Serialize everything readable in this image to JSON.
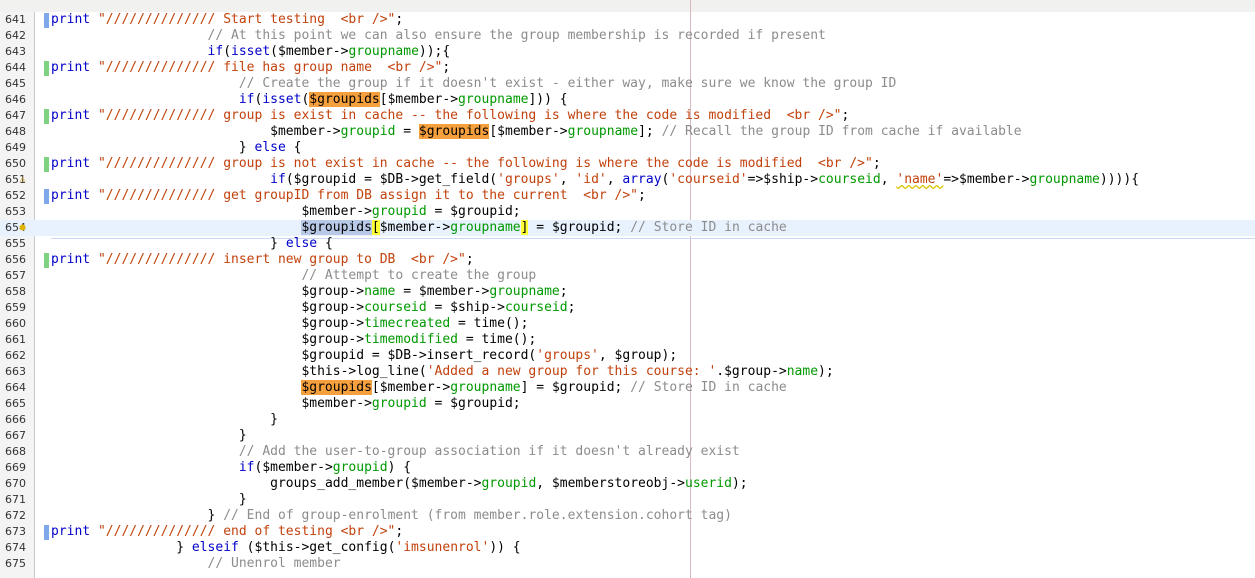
{
  "editor": {
    "lines": [
      {
        "n": "641",
        "ann": "b",
        "mark": "",
        "ind": 0,
        "segs": [
          [
            "kw",
            "print "
          ],
          [
            "str",
            "\"////////////// Start testing  <br />\""
          ],
          [
            "",
            "; "
          ]
        ]
      },
      {
        "n": "642",
        "ann": "",
        "mark": "",
        "ind": 20,
        "segs": [
          [
            "cm",
            "// At this point we can also ensure the group membership is recorded if present"
          ]
        ]
      },
      {
        "n": "643",
        "ann": "",
        "mark": "",
        "ind": 20,
        "segs": [
          [
            "kw",
            "if"
          ],
          [
            "",
            "("
          ],
          [
            "kw",
            "isset"
          ],
          [
            "",
            "($member->"
          ],
          [
            "fld",
            "groupname"
          ],
          [
            "",
            "));{"
          ]
        ]
      },
      {
        "n": "644",
        "ann": "g",
        "mark": "",
        "ind": 0,
        "segs": [
          [
            "kw",
            "print "
          ],
          [
            "str",
            "\"////////////// file has group name  <br />\""
          ],
          [
            "",
            ";"
          ]
        ]
      },
      {
        "n": "645",
        "ann": "",
        "mark": "",
        "ind": 24,
        "segs": [
          [
            "cm",
            "// Create the group if it doesn't exist - either way, make sure we know the group ID"
          ]
        ]
      },
      {
        "n": "646",
        "ann": "",
        "mark": "",
        "ind": 24,
        "segs": [
          [
            "kw",
            "if"
          ],
          [
            "",
            "("
          ],
          [
            "kw",
            "isset"
          ],
          [
            "",
            "("
          ],
          [
            "hl",
            "$groupids"
          ],
          [
            "",
            "[$member->"
          ],
          [
            "fld",
            "groupname"
          ],
          [
            "",
            "])) {"
          ]
        ]
      },
      {
        "n": "647",
        "ann": "g",
        "mark": "",
        "ind": 0,
        "segs": [
          [
            "kw",
            "print "
          ],
          [
            "str",
            "\"////////////// group is exist in cache -- the following is where the code is modified  <br />\""
          ],
          [
            "",
            ";"
          ]
        ]
      },
      {
        "n": "648",
        "ann": "",
        "mark": "",
        "ind": 28,
        "segs": [
          [
            "",
            "$member->"
          ],
          [
            "fld",
            "groupid"
          ],
          [
            "",
            " = "
          ],
          [
            "hl",
            "$groupids"
          ],
          [
            "",
            "[$member->"
          ],
          [
            "fld",
            "groupname"
          ],
          [
            "",
            "]; "
          ],
          [
            "cm",
            "// Recall the group ID from cache if available"
          ]
        ]
      },
      {
        "n": "649",
        "ann": "",
        "mark": "",
        "ind": 24,
        "segs": [
          [
            "",
            "} "
          ],
          [
            "kw",
            "else"
          ],
          [
            "",
            " {"
          ]
        ]
      },
      {
        "n": "650",
        "ann": "g",
        "mark": "",
        "ind": 0,
        "segs": [
          [
            "kw",
            "print "
          ],
          [
            "str",
            "\"////////////// group is not exist in cache -- the following is where the code is modified  <br />\""
          ],
          [
            "",
            ";"
          ]
        ]
      },
      {
        "n": "651",
        "ann": "",
        "mark": "warn-icon",
        "ind": 28,
        "segs": [
          [
            "kw",
            "if"
          ],
          [
            "",
            "($groupid = $DB->get_field("
          ],
          [
            "str",
            "'groups'"
          ],
          [
            "",
            ", "
          ],
          [
            "str",
            "'id'"
          ],
          [
            "",
            ", "
          ],
          [
            "kw",
            "array"
          ],
          [
            "",
            "("
          ],
          [
            "str",
            "'courseid'"
          ],
          [
            "",
            "=>$ship->"
          ],
          [
            "fld",
            "courseid"
          ],
          [
            "",
            ", "
          ],
          [
            "str wav",
            "'name'"
          ],
          [
            "",
            "=>$member->"
          ],
          [
            "fld",
            "groupname"
          ],
          [
            "",
            ")))){"
          ]
        ]
      },
      {
        "n": "652",
        "ann": "b",
        "mark": "",
        "ind": 0,
        "segs": [
          [
            "kw",
            "print "
          ],
          [
            "str",
            "\"////////////// get groupID from DB assign it to the current  <br />\""
          ],
          [
            "",
            ";"
          ]
        ]
      },
      {
        "n": "653",
        "ann": "",
        "mark": "",
        "ind": 32,
        "segs": [
          [
            "",
            "$member->"
          ],
          [
            "fld",
            "groupid"
          ],
          [
            "",
            " = $groupid;"
          ]
        ]
      },
      {
        "n": "654",
        "ann": "",
        "mark": "hint-icon",
        "ind": 32,
        "cur": true,
        "segs": [
          [
            "sel",
            "$groupids"
          ],
          [
            "bm",
            "["
          ],
          [
            "",
            "$member->"
          ],
          [
            "fld",
            "groupname"
          ],
          [
            "bm",
            "]"
          ],
          [
            "",
            " = $groupid; "
          ],
          [
            "cm",
            "// Store ID in cache"
          ]
        ]
      },
      {
        "n": "655",
        "ann": "",
        "mark": "",
        "ind": 28,
        "segs": [
          [
            "",
            "} "
          ],
          [
            "kw",
            "else"
          ],
          [
            "",
            " {"
          ]
        ]
      },
      {
        "n": "656",
        "ann": "g",
        "mark": "",
        "ind": 0,
        "segs": [
          [
            "kw",
            "print "
          ],
          [
            "str",
            "\"////////////// insert new group to DB  <br />\""
          ],
          [
            "",
            ";"
          ]
        ]
      },
      {
        "n": "657",
        "ann": "",
        "mark": "",
        "ind": 32,
        "segs": [
          [
            "cm",
            "// Attempt to create the group"
          ]
        ]
      },
      {
        "n": "658",
        "ann": "",
        "mark": "",
        "ind": 32,
        "segs": [
          [
            "",
            "$group->"
          ],
          [
            "fld",
            "name"
          ],
          [
            "",
            " = $member->"
          ],
          [
            "fld",
            "groupname"
          ],
          [
            "",
            ";"
          ]
        ]
      },
      {
        "n": "659",
        "ann": "",
        "mark": "",
        "ind": 32,
        "segs": [
          [
            "",
            "$group->"
          ],
          [
            "fld",
            "courseid"
          ],
          [
            "",
            " = $ship->"
          ],
          [
            "fld",
            "courseid"
          ],
          [
            "",
            ";"
          ]
        ]
      },
      {
        "n": "660",
        "ann": "",
        "mark": "",
        "ind": 32,
        "segs": [
          [
            "",
            "$group->"
          ],
          [
            "fld",
            "timecreated"
          ],
          [
            "",
            " = time();"
          ]
        ]
      },
      {
        "n": "661",
        "ann": "",
        "mark": "",
        "ind": 32,
        "segs": [
          [
            "",
            "$group->"
          ],
          [
            "fld",
            "timemodified"
          ],
          [
            "",
            " = time();"
          ]
        ]
      },
      {
        "n": "662",
        "ann": "",
        "mark": "",
        "ind": 32,
        "segs": [
          [
            "",
            "$groupid = $DB->insert_record("
          ],
          [
            "str",
            "'groups'"
          ],
          [
            "",
            ", $group);"
          ]
        ]
      },
      {
        "n": "663",
        "ann": "",
        "mark": "",
        "ind": 32,
        "segs": [
          [
            "",
            "$this->log_line("
          ],
          [
            "str",
            "'Added a new group for this course: '"
          ],
          [
            "",
            ".$group->"
          ],
          [
            "fld",
            "name"
          ],
          [
            "",
            ");"
          ]
        ]
      },
      {
        "n": "664",
        "ann": "",
        "mark": "",
        "ind": 32,
        "segs": [
          [
            "hl",
            "$groupids"
          ],
          [
            "",
            "[$member->"
          ],
          [
            "fld",
            "groupname"
          ],
          [
            "",
            "] = $groupid; "
          ],
          [
            "cm",
            "// Store ID in cache"
          ]
        ]
      },
      {
        "n": "665",
        "ann": "",
        "mark": "",
        "ind": 32,
        "segs": [
          [
            "",
            "$member->"
          ],
          [
            "fld",
            "groupid"
          ],
          [
            "",
            " = $groupid;"
          ]
        ]
      },
      {
        "n": "666",
        "ann": "",
        "mark": "",
        "ind": 28,
        "segs": [
          [
            "",
            "}"
          ]
        ]
      },
      {
        "n": "667",
        "ann": "",
        "mark": "",
        "ind": 24,
        "segs": [
          [
            "",
            "}"
          ]
        ]
      },
      {
        "n": "668",
        "ann": "",
        "mark": "",
        "ind": 24,
        "segs": [
          [
            "cm",
            "// Add the user-to-group association if it doesn't already exist"
          ]
        ]
      },
      {
        "n": "669",
        "ann": "",
        "mark": "",
        "ind": 24,
        "segs": [
          [
            "kw",
            "if"
          ],
          [
            "",
            "($member->"
          ],
          [
            "fld",
            "groupid"
          ],
          [
            "",
            ") {"
          ]
        ]
      },
      {
        "n": "670",
        "ann": "",
        "mark": "",
        "ind": 28,
        "segs": [
          [
            "",
            "groups_add_member($member->"
          ],
          [
            "fld",
            "groupid"
          ],
          [
            "",
            ", $memberstoreobj->"
          ],
          [
            "fld",
            "userid"
          ],
          [
            "",
            ");"
          ]
        ]
      },
      {
        "n": "671",
        "ann": "",
        "mark": "",
        "ind": 24,
        "segs": [
          [
            "",
            "}"
          ]
        ]
      },
      {
        "n": "672",
        "ann": "",
        "mark": "",
        "ind": 20,
        "segs": [
          [
            "",
            "} "
          ],
          [
            "cm",
            "// End of group-enrolment (from member.role.extension.cohort tag)"
          ]
        ]
      },
      {
        "n": "673",
        "ann": "b",
        "mark": "",
        "ind": 0,
        "segs": [
          [
            "kw",
            "print "
          ],
          [
            "str",
            "\"////////////// end of testing <br />\""
          ],
          [
            "",
            ";"
          ]
        ]
      },
      {
        "n": "674",
        "ann": "",
        "mark": "",
        "ind": 16,
        "segs": [
          [
            "",
            "} "
          ],
          [
            "kw",
            "elseif"
          ],
          [
            "",
            " ($this->get_config("
          ],
          [
            "str",
            "'imsunenrol'"
          ],
          [
            "",
            ")) {"
          ]
        ]
      },
      {
        "n": "675",
        "ann": "",
        "mark": "",
        "ind": 20,
        "segs": [
          [
            "cm",
            "// Unenrol member"
          ]
        ]
      }
    ]
  }
}
